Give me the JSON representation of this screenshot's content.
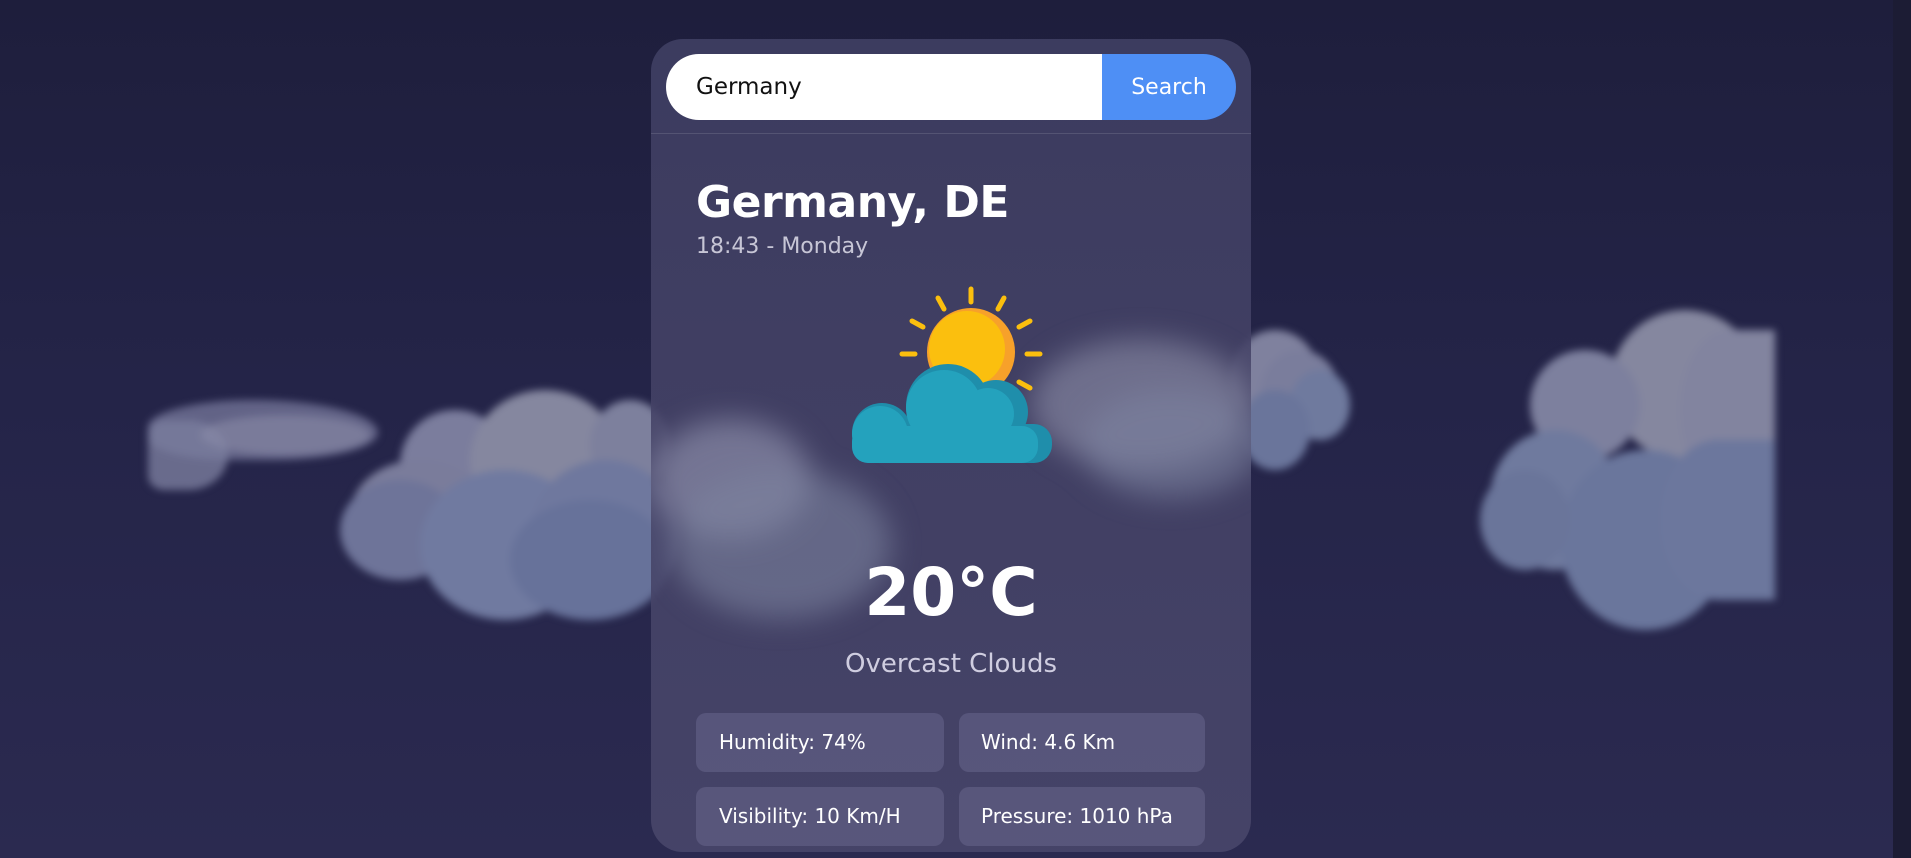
{
  "search": {
    "value": "Germany",
    "button_label": "Search"
  },
  "weather": {
    "location": "Germany, DE",
    "datetime": "18:43 - Monday",
    "temperature": "20°C",
    "condition": "Overcast Clouds",
    "icon": "partly-cloudy-icon"
  },
  "stats": {
    "humidity": "Humidity: 74%",
    "wind": "Wind: 4.6 Km",
    "visibility": "Visibility: 10 Km/H",
    "pressure": "Pressure: 1010 hPa"
  },
  "colors": {
    "background": "#242448",
    "card": "#44426a",
    "accent": "#4e8ff5",
    "sun": "#fbbf0e",
    "cloud": "#24a2bd"
  }
}
